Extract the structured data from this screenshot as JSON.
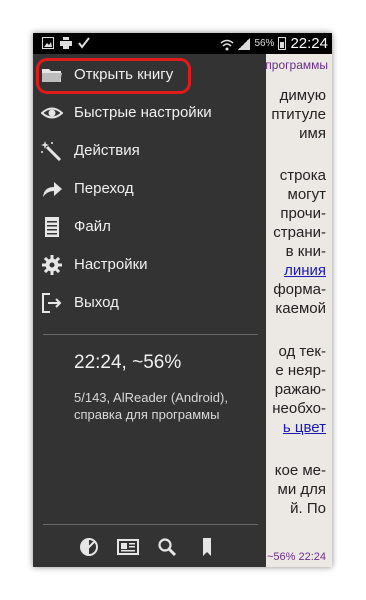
{
  "status_bar": {
    "battery_text": "56%",
    "time": "22:24"
  },
  "reader": {
    "header": "программы",
    "lines": [
      "димую",
      "птитуле",
      "имя",
      "строка",
      "могут",
      "прочи-",
      "страни-",
      "в кни-",
      "линия",
      "форма-",
      "каемой",
      "од тек-",
      "е неяр-",
      "ражаю-",
      "необхо-",
      "ь цвет",
      "кое ме-",
      "ми для",
      "й.   По"
    ],
    "footer": "~56% 22:24"
  },
  "drawer": {
    "items": [
      {
        "label": "Открыть книгу",
        "icon": "folder-icon"
      },
      {
        "label": "Быстрые настройки",
        "icon": "eye-icon"
      },
      {
        "label": "Действия",
        "icon": "magic-wand-icon"
      },
      {
        "label": "Переход",
        "icon": "arrow-forward-icon"
      },
      {
        "label": "Файл",
        "icon": "file-icon"
      },
      {
        "label": "Настройки",
        "icon": "gear-icon"
      },
      {
        "label": "Выход",
        "icon": "exit-icon"
      }
    ],
    "status_line": "22:24, ~56%",
    "book_info": "5/143, AlReader (Android), справка для программы",
    "bottom_icons": [
      "contrast-icon",
      "screen-icon",
      "search-icon",
      "bookmark-icon"
    ]
  },
  "colors": {
    "drawer_bg": "#333333",
    "highlight": "#e21a1a",
    "link": "#1a1ab0",
    "header_text": "#6a2f8a"
  }
}
